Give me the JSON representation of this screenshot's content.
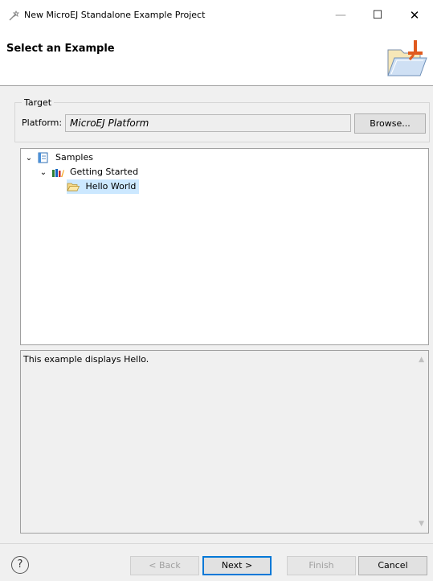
{
  "window": {
    "title": "New MicroEJ Standalone Example Project",
    "minimize_glyph": "—",
    "maximize_glyph": "☐",
    "close_glyph": "✕"
  },
  "header": {
    "title": "Select an Example"
  },
  "target": {
    "group_label": "Target",
    "platform_label": "Platform:",
    "platform_value": "MicroEJ Platform",
    "browse_label": "Browse..."
  },
  "tree": {
    "items": [
      {
        "label": "Samples",
        "chevron": "v",
        "icon": "book-icon"
      },
      {
        "label": "Getting Started",
        "chevron": "v",
        "icon": "library-icon"
      },
      {
        "label": "Hello World",
        "chevron": "",
        "icon": "folder-open-icon",
        "selected": true
      }
    ]
  },
  "description": {
    "text": "This example displays Hello.",
    "scroll_up": "▲",
    "scroll_down": "▼"
  },
  "footer": {
    "help_glyph": "?",
    "back_label": "< Back",
    "next_label": "Next >",
    "finish_label": "Finish",
    "cancel_label": "Cancel"
  },
  "colors": {
    "selection": "#cce8ff",
    "default_button_border": "#0078d7",
    "disabled_text": "#a0a0a0"
  }
}
